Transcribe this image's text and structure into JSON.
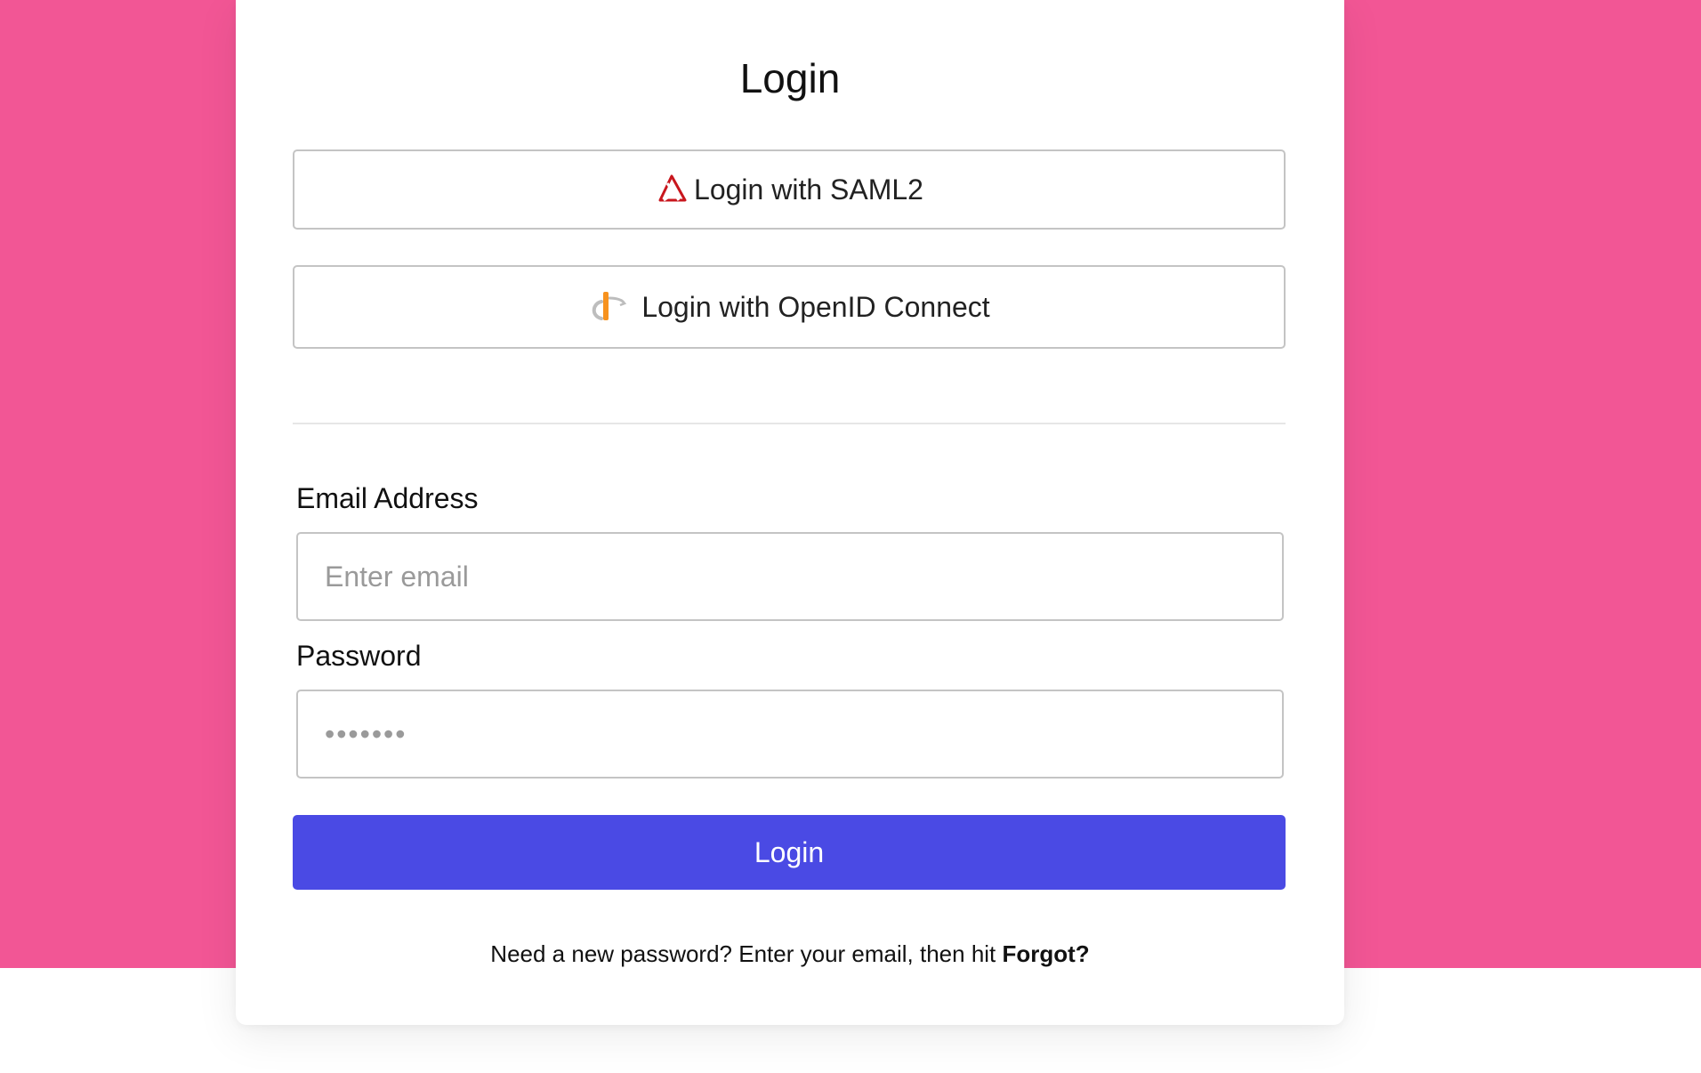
{
  "page": {
    "title": "Login",
    "background_color": "#f25695",
    "accent_color": "#4a4ae4"
  },
  "sso": {
    "saml": {
      "label": "Login with SAML2",
      "icon": "saml-icon"
    },
    "oidc": {
      "label": "Login with OpenID Connect",
      "icon": "openid-icon"
    }
  },
  "form": {
    "email": {
      "label": "Email Address",
      "placeholder": "Enter email",
      "value": ""
    },
    "password": {
      "label": "Password",
      "placeholder": "•••••••",
      "value": ""
    },
    "submit_label": "Login"
  },
  "help": {
    "text": "Need a new password? Enter your email, then hit ",
    "link_label": "Forgot?"
  }
}
